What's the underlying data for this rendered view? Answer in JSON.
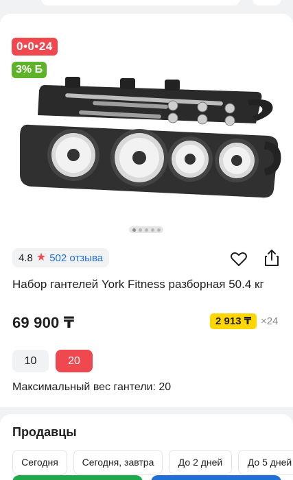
{
  "product": {
    "promo_badge": "0•0•24",
    "bonus_badge": "3% Б",
    "image_alt": "Набор гантелей York Fitness в кейсе",
    "rating": "4.8",
    "reviews": "502 отзыва",
    "title": "Набор гантелей York Fitness разборная 50.4 кг",
    "price": "69 900 ₸",
    "installment": {
      "amount": "2 913 ₸",
      "multiplier": "×24"
    },
    "options": [
      {
        "label": "10",
        "selected": false
      },
      {
        "label": "20",
        "selected": true
      }
    ],
    "spec_text": "Максимальный вес гантели: 20"
  },
  "sellers": {
    "title": "Продавцы",
    "filters": [
      "Сегодня",
      "Сегодня, завтра",
      "До 2 дней",
      "До 5 дней"
    ]
  },
  "colors": {
    "accent_red": "#f0484f",
    "accent_green": "#5fb32a",
    "installment_yellow": "#ffd600",
    "link_blue": "#1f6fd6"
  },
  "icons": {
    "rating": "star-icon",
    "favorite": "heart-icon",
    "share": "share-icon"
  },
  "gallery": {
    "page_count": 5,
    "active_index": 0
  }
}
